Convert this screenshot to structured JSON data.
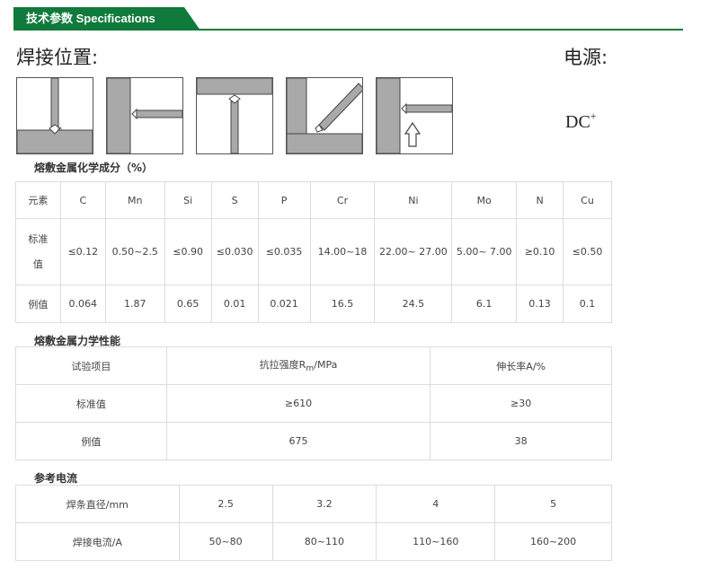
{
  "header": {
    "title": "技术参数 Specifications"
  },
  "welding_position": {
    "label": "焊接位置:"
  },
  "power_source": {
    "label": "电源:",
    "value": "DC",
    "polarity": "+"
  },
  "composition": {
    "title": "熔敷金属化学成分（%）",
    "header_label": "元素",
    "elements": [
      "C",
      "Mn",
      "Si",
      "S",
      "P",
      "Cr",
      "Ni",
      "Mo",
      "N",
      "Cu"
    ],
    "rows": [
      {
        "label_lines": [
          "标准",
          "值"
        ],
        "values": [
          "≤0.12",
          "0.50~2.5",
          "≤0.90",
          "≤0.030",
          "≤0.035",
          "14.00~18",
          "22.00~ 27.00",
          "5.00~ 7.00",
          "≥0.10",
          "≤0.50"
        ]
      },
      {
        "label_lines": [
          "例值"
        ],
        "values": [
          "0.064",
          "1.87",
          "0.65",
          "0.01",
          "0.021",
          "16.5",
          "24.5",
          "6.1",
          "0.13",
          "0.1"
        ]
      }
    ]
  },
  "mechanical": {
    "title": "熔敷金属力学性能",
    "headers": [
      "试验项目",
      "抗拉强度R",
      "m",
      "/MPa",
      "伸长率A/%"
    ],
    "rows": [
      [
        "标准值",
        "≥610",
        "≥30"
      ],
      [
        "例值",
        "675",
        "38"
      ]
    ]
  },
  "current": {
    "title": "参考电流",
    "rows": [
      [
        "焊条直径/mm",
        "2.5",
        "3.2",
        "4",
        "5"
      ],
      [
        "焊接电流/A",
        "50~80",
        "80~110",
        "110~160",
        "160~200"
      ]
    ]
  },
  "colors": {
    "brand_green": "#0f7a3c",
    "plate_gray": "#a9a9a9"
  }
}
